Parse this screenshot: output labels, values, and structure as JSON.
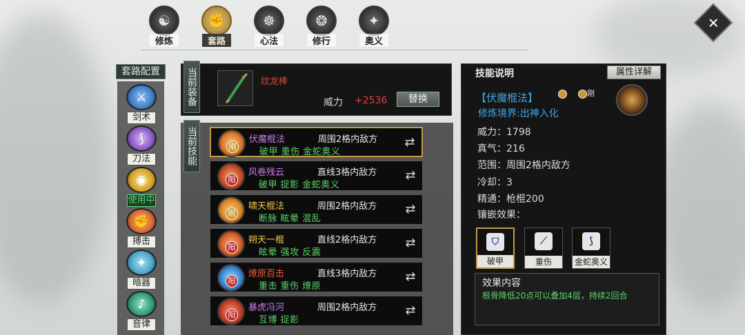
{
  "tabs": [
    {
      "label": "修炼",
      "glyph": "☯"
    },
    {
      "label": "套路",
      "glyph": "✊"
    },
    {
      "label": "心法",
      "glyph": "☸"
    },
    {
      "label": "修行",
      "glyph": "❂"
    },
    {
      "label": "奥义",
      "glyph": "✦"
    }
  ],
  "active_tab": 1,
  "close_icon": "close-icon",
  "left": {
    "title": "套路配置",
    "categories": [
      {
        "label": "剑术",
        "color": "#3f7fc8"
      },
      {
        "label": "刀法",
        "color": "#8a5bc8"
      },
      {
        "label": "使用中",
        "color": "#d8a227"
      },
      {
        "label": "搏击",
        "color": "#d86a30"
      },
      {
        "label": "暗器",
        "color": "#4aa6c8"
      },
      {
        "label": "音律",
        "color": "#2f9a7a"
      }
    ]
  },
  "equip": {
    "vlabel": "当前装备",
    "weapon_name": "纹龙棒",
    "power_label": "威力",
    "power_value": "+2536",
    "replace_label": "替换"
  },
  "skills_section": {
    "vlabel": "当前技能",
    "skills": [
      {
        "name": "伏魔棍法",
        "name_color": "#c87de8",
        "range": "周围2格内敌方",
        "effects": "破甲 重伤 金蛇奥义",
        "badge": "刚",
        "badge_color": "#c99a30",
        "icon_color": "#e07a2a"
      },
      {
        "name": "风卷残云",
        "name_color": "#c87de8",
        "range": "直线3格内敌方",
        "effects": "破甲 捉影 金蛇奥义",
        "badge": "阳",
        "badge_color": "#c02a2a",
        "icon_color": "#c8502a"
      },
      {
        "name": "啸天棍法",
        "name_color": "#f0c64a",
        "range": "周围2格内敌方",
        "effects": "断脉 眩晕 混乱",
        "badge": "刚",
        "badge_color": "#c99a30",
        "icon_color": "#e08a2a"
      },
      {
        "name": "朔天一棍",
        "name_color": "#f0c64a",
        "range": "直线2格内敌方",
        "effects": "眩晕 强攻 反震",
        "badge": "阳",
        "badge_color": "#c02a2a",
        "icon_color": "#d8602a"
      },
      {
        "name": "燎原百击",
        "name_color": "#e85a3a",
        "range": "直线3格内敌方",
        "effects": "重击 重伤 燎原",
        "badge": "阳",
        "badge_color": "#c02a2a",
        "icon_color": "#3a8ad8"
      },
      {
        "name": "暴虎冯河",
        "name_color": "#c87de8",
        "range": "周围2格内敌方",
        "effects": "互博 捉影",
        "badge": "阳",
        "badge_color": "#c02a2a",
        "icon_color": "#c8402a"
      }
    ]
  },
  "detail": {
    "title": "技能说明",
    "attr_button": "属性详解",
    "skill_name": "【伏魔棍法】",
    "badge": "刚",
    "realm": "修炼境界:出神入化",
    "stats": [
      "威力：1798",
      "真气：216",
      "范围：周围2格内敌方",
      "冷却：3",
      "精通：枪棍200"
    ],
    "inlay_title": "镶嵌效果：",
    "inlays": [
      {
        "label": "破甲",
        "glyph": "⛉"
      },
      {
        "label": "重伤",
        "glyph": "⟋"
      },
      {
        "label": "金蛇奥义",
        "glyph": "⟆"
      }
    ],
    "effect_title": "效果内容",
    "effect_text": "根骨降低20点可以叠加4层，持续2回合"
  }
}
